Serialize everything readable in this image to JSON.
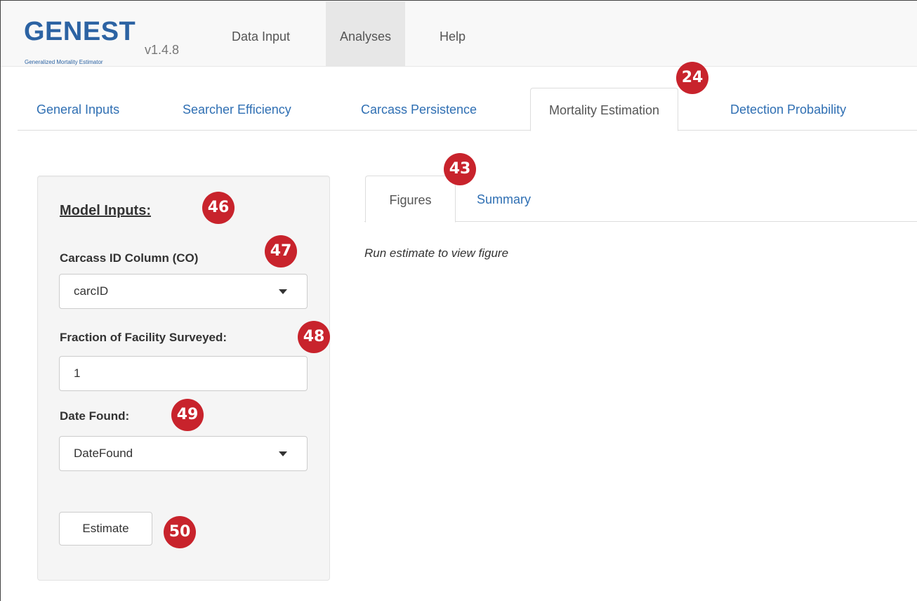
{
  "app": {
    "logo_text": "GENEST",
    "logo_subtitle": "Generalized Mortality Estimator",
    "version": "v1.4.8"
  },
  "navbar": {
    "items": [
      {
        "label": "Data Input"
      },
      {
        "label": "Analyses",
        "active": true
      },
      {
        "label": "Help"
      }
    ]
  },
  "tabs": [
    {
      "label": "General Inputs"
    },
    {
      "label": "Searcher Efficiency"
    },
    {
      "label": "Carcass Persistence"
    },
    {
      "label": "Mortality Estimation",
      "active": true
    },
    {
      "label": "Detection Probability"
    }
  ],
  "sidebar": {
    "title": "Model Inputs:",
    "carcass_id": {
      "label": "Carcass ID Column (CO)",
      "value": "carcID"
    },
    "fraction": {
      "label": "Fraction of Facility Surveyed:",
      "value": "1"
    },
    "date_found": {
      "label": "Date Found:",
      "value": "DateFound"
    },
    "estimate_button": "Estimate"
  },
  "main": {
    "subtabs": [
      {
        "label": "Figures",
        "active": true
      },
      {
        "label": "Summary"
      }
    ],
    "message": "Run estimate to view figure"
  },
  "callouts": [
    "24",
    "43",
    "46",
    "47",
    "48",
    "49",
    "50"
  ],
  "colors": {
    "callout": "#c8232c",
    "link": "#2f6fb3",
    "brand": "#2c63a3"
  }
}
